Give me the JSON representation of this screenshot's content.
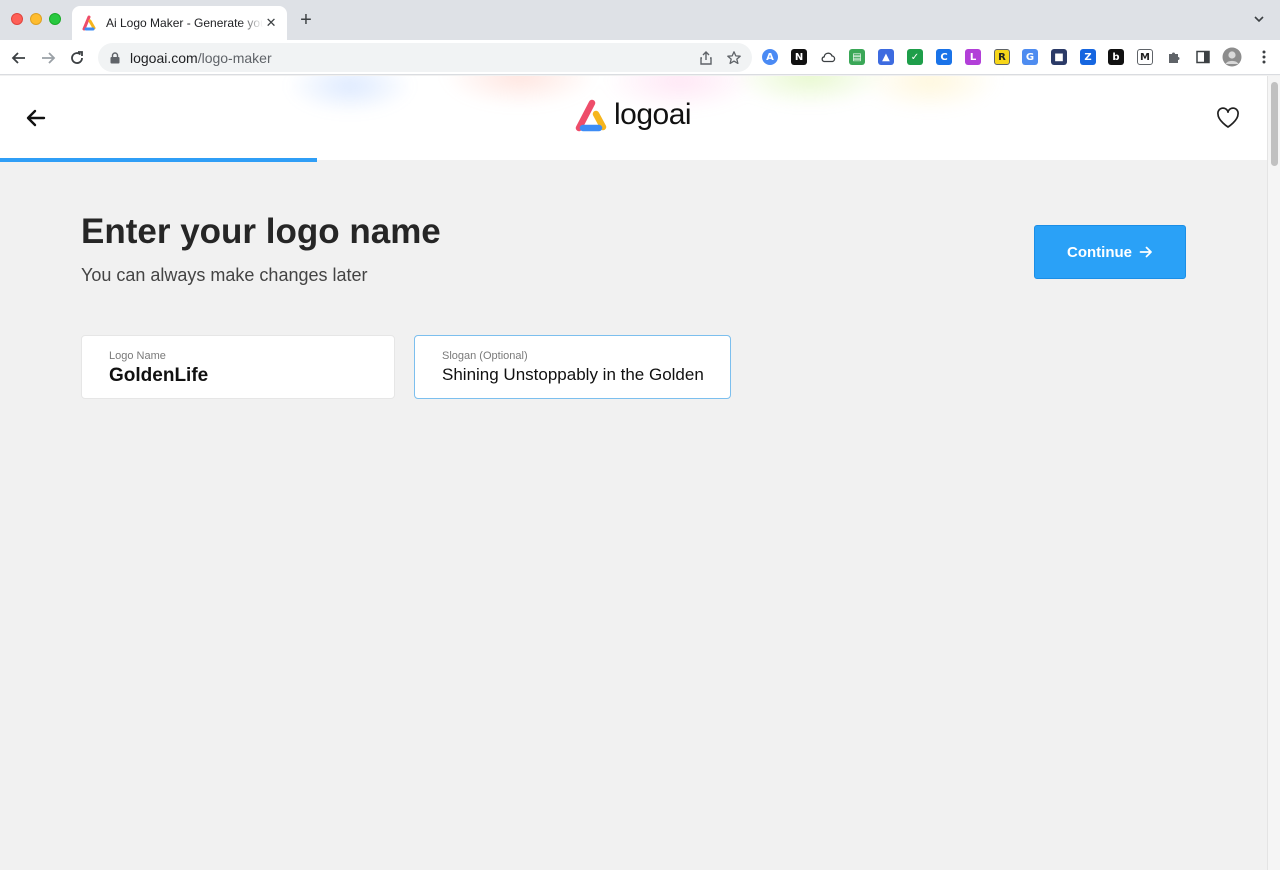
{
  "browser": {
    "tab_title": "Ai Logo Maker - Generate your",
    "tab_close": "✕",
    "new_tab": "+",
    "url_host": "logoai.com",
    "url_path": "/logo-maker",
    "extensions": [
      {
        "icon": "arc-extension-icon",
        "color": "#4a8af4",
        "glyph": "A"
      },
      {
        "icon": "notion-extension-icon",
        "color": "#111111",
        "glyph": "N"
      },
      {
        "icon": "cloud-extension-icon",
        "color": "#ffffff",
        "glyph": ""
      },
      {
        "icon": "green-reader-extension-icon",
        "color": "#3aa757",
        "glyph": "▤"
      },
      {
        "icon": "blue-screenshot-extension-icon",
        "color": "#3d6be0",
        "glyph": "▲"
      },
      {
        "icon": "checkmark-extension-icon",
        "color": "#1e9e4a",
        "glyph": "✓"
      },
      {
        "icon": "blue-circle-extension-icon",
        "color": "#1a73e8",
        "glyph": "C"
      },
      {
        "icon": "purple-lr-extension-icon",
        "color": "#b23fd8",
        "glyph": "L"
      },
      {
        "icon": "yellow-r-extension-icon",
        "color": "#f7d61a",
        "glyph": "R"
      },
      {
        "icon": "translate-extension-icon",
        "color": "#4e8cf0",
        "glyph": "G"
      },
      {
        "icon": "dark-photo-extension-icon",
        "color": "#2b3a67",
        "glyph": "■"
      },
      {
        "icon": "z-extension-icon",
        "color": "#1666e0",
        "glyph": "Z"
      },
      {
        "icon": "b-extension-icon",
        "color": "#111111",
        "glyph": "b"
      },
      {
        "icon": "m-extension-icon",
        "color": "#ffffff",
        "glyph": "M"
      }
    ]
  },
  "colors": {
    "accent": "#2aa1f7",
    "progress": "#2f9ef6",
    "brand_pink": "#ee4d6a",
    "brand_blue": "#3d8cf5",
    "brand_yellow": "#f6b51d"
  },
  "header": {
    "brand_name": "logoai",
    "progress": 0.25
  },
  "main": {
    "heading": "Enter your logo name",
    "subheading": "You can always make changes later",
    "continue_label": "Continue",
    "logo_name": {
      "label": "Logo Name",
      "value": "GoldenLife"
    },
    "slogan": {
      "label": "Slogan (Optional)",
      "value": "Shining Unstoppably in the Golden Years"
    }
  }
}
